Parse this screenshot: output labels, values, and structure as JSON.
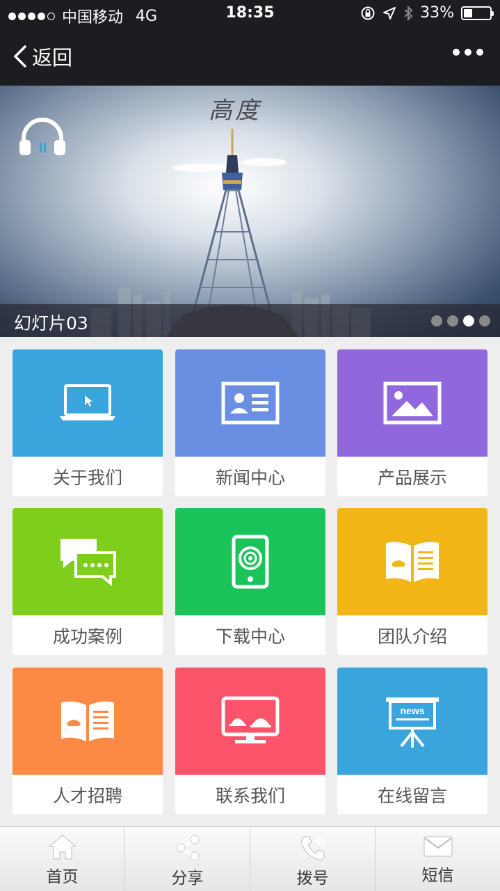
{
  "status_bar": {
    "carrier": "中国移动",
    "network": "4G",
    "time": "18:35",
    "battery": "33%",
    "battery_level": 0.33,
    "signal_bars": 4
  },
  "nav": {
    "back_label": "返回"
  },
  "banner": {
    "caption": "幻灯片03",
    "logo_text": "高度",
    "slide_count": 4,
    "active_slide": 3
  },
  "tiles": [
    {
      "label": "关于我们",
      "color": "#3aa5dc",
      "icon": "laptop-icon"
    },
    {
      "label": "新闻中心",
      "color": "#6a8ee2",
      "icon": "id-card-icon"
    },
    {
      "label": "产品展示",
      "color": "#9067dd",
      "icon": "picture-icon"
    },
    {
      "label": "成功案例",
      "color": "#7fce1b",
      "icon": "chat-bubbles-icon"
    },
    {
      "label": "下载中心",
      "color": "#1bc45a",
      "icon": "phone-icon"
    },
    {
      "label": "团队介绍",
      "color": "#f2b516",
      "icon": "open-book-icon"
    },
    {
      "label": "人才招聘",
      "color": "#fd8a44",
      "icon": "open-book-icon"
    },
    {
      "label": "联系我们",
      "color": "#fb536a",
      "icon": "monitor-icon"
    },
    {
      "label": "在线留言",
      "color": "#3aa5dc",
      "icon": "news-board-icon"
    }
  ],
  "tabbar": [
    {
      "label": "首页",
      "icon": "home-icon"
    },
    {
      "label": "分享",
      "icon": "share-icon"
    },
    {
      "label": "拨号",
      "icon": "phone-call-icon"
    },
    {
      "label": "短信",
      "icon": "envelope-icon"
    }
  ]
}
